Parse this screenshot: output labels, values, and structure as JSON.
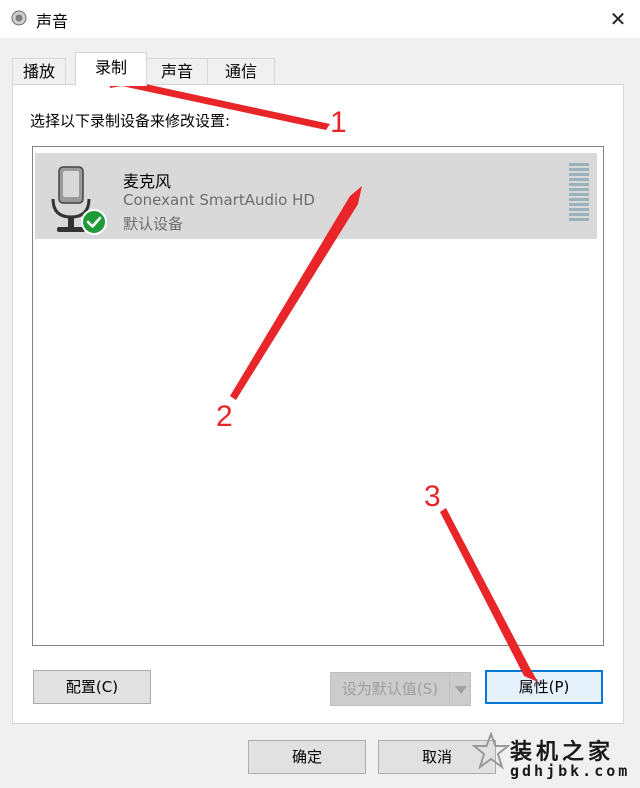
{
  "window": {
    "title": "声音",
    "close_glyph": "✕"
  },
  "tabs": [
    {
      "label": "播放",
      "active": false
    },
    {
      "label": "录制",
      "active": true
    },
    {
      "label": "声音",
      "active": false
    },
    {
      "label": "通信",
      "active": false
    }
  ],
  "recording": {
    "instruction": "选择以下录制设备来修改设置:",
    "devices": [
      {
        "name": "麦克风",
        "description": "Conexant SmartAudio HD",
        "status": "默认设备",
        "icon": "microphone-icon",
        "badge": "checkmark-icon"
      }
    ]
  },
  "buttons": {
    "configure": "配置(C)",
    "set_default": "设为默认值(S)",
    "properties": "属性(P)",
    "ok": "确定",
    "cancel": "取消"
  },
  "annotations": {
    "step1": "1",
    "step2": "2",
    "step3": "3",
    "color": "#e8262a"
  },
  "watermark": {
    "name": "装机之家",
    "site": "gdhjbk.com"
  }
}
